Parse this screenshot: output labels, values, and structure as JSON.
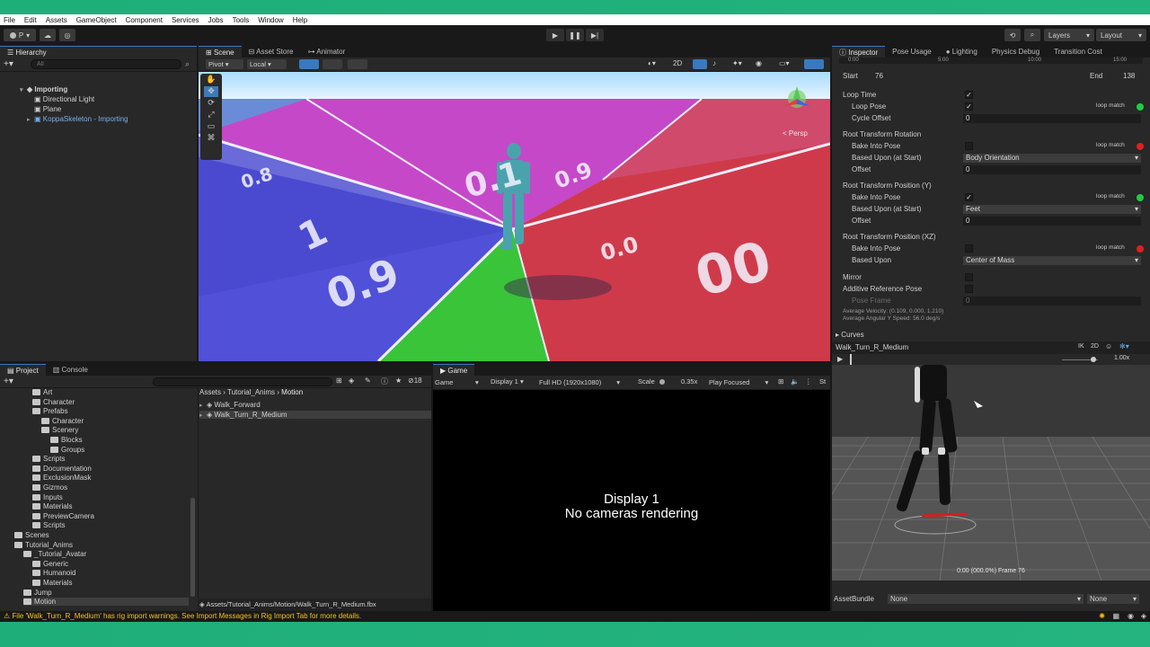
{
  "menu": [
    "File",
    "Edit",
    "Assets",
    "GameObject",
    "Component",
    "Services",
    "Jobs",
    "Tools",
    "Window",
    "Help"
  ],
  "toolbar": {
    "account": "P",
    "layers": "Layers",
    "layout": "Layout"
  },
  "hierarchy": {
    "tab": "Hierarchy",
    "search_placeholder": "All",
    "items": [
      "Importing",
      "Directional Light",
      "Plane",
      "KoppaSkeleton - Importing"
    ]
  },
  "scene": {
    "tabs": [
      "Scene",
      "Asset Store",
      "Animator"
    ],
    "pivot": "Pivot",
    "local": "Local",
    "mode_2d": "2D",
    "persp": "< Persp"
  },
  "inspector": {
    "tabs": [
      "Inspector",
      "Pose Usage",
      "Lighting",
      "Physics Debug",
      "Transition Cost"
    ],
    "timeline_ticks": [
      "0:00",
      "5:00",
      "10:00",
      "15:00"
    ],
    "start_label": "Start",
    "start_value": "76",
    "end_label": "End",
    "end_value": "138",
    "rows": {
      "loop_time": "Loop Time",
      "loop_pose": "Loop Pose",
      "cycle_offset": "Cycle Offset",
      "cycle_offset_value": "0",
      "root_rotation": "Root Transform Rotation",
      "bake_into_pose": "Bake Into Pose",
      "based_upon_start": "Based Upon (at Start)",
      "rotation_based_value": "Body Orientation",
      "offset": "Offset",
      "rotation_offset_value": "0",
      "root_position_y": "Root Transform Position (Y)",
      "position_y_based_value": "Feet",
      "position_y_offset_value": "0",
      "root_position_xz": "Root Transform Position (XZ)",
      "based_upon": "Based Upon",
      "position_xz_based_value": "Center of Mass",
      "mirror": "Mirror",
      "additive_reference_pose": "Additive Reference Pose",
      "pose_frame": "Pose Frame",
      "pose_frame_value": "0",
      "loop_match": "loop match",
      "average_velocity": "Average Velocity: (0.109, 0.000, 1.210)",
      "average_angular": "Average Angular Y Speed: 56.0 deg/s",
      "curves": "Curves"
    },
    "preview_clip": "Walk_Turn_R_Medium",
    "preview_ik": "IK",
    "preview_2d": "2D",
    "preview_speed": "1.00x",
    "preview_time": "0:00 (000.0%) Frame 76",
    "assetbundle_label": "AssetBundle",
    "assetbundle_value": "None",
    "assetbundle_variant": "None"
  },
  "project": {
    "tabs": [
      "Project",
      "Console"
    ],
    "count": "18",
    "tree": [
      {
        "label": "Art",
        "indent": 3
      },
      {
        "label": "Character",
        "indent": 3
      },
      {
        "label": "Prefabs",
        "indent": 3
      },
      {
        "label": "Character",
        "indent": 4
      },
      {
        "label": "Scenery",
        "indent": 4
      },
      {
        "label": "Blocks",
        "indent": 5
      },
      {
        "label": "Groups",
        "indent": 5
      },
      {
        "label": "Scripts",
        "indent": 3
      },
      {
        "label": "Documentation",
        "indent": 3
      },
      {
        "label": "ExclusionMask",
        "indent": 3
      },
      {
        "label": "Gizmos",
        "indent": 3
      },
      {
        "label": "Inputs",
        "indent": 3
      },
      {
        "label": "Materials",
        "indent": 3
      },
      {
        "label": "PreviewCamera",
        "indent": 3
      },
      {
        "label": "Scripts",
        "indent": 3
      },
      {
        "label": "Scenes",
        "indent": 1
      },
      {
        "label": "Tutorial_Anims",
        "indent": 1
      },
      {
        "label": "_Tutorial_Avatar",
        "indent": 2
      },
      {
        "label": "Generic",
        "indent": 3
      },
      {
        "label": "Humanoid",
        "indent": 3
      },
      {
        "label": "Materials",
        "indent": 3
      },
      {
        "label": "Jump",
        "indent": 2
      },
      {
        "label": "Motion",
        "indent": 2
      }
    ],
    "breadcrumb": [
      "Assets",
      "Tutorial_Anims",
      "Motion"
    ],
    "files": [
      "Walk_Forward",
      "Walk_Turn_R_Medium"
    ],
    "path": "Assets/Tutorial_Anims/Motion/Walk_Turn_R_Medium.fbx"
  },
  "game": {
    "tab": "Game",
    "mode": "Game",
    "display": "Display 1",
    "resolution": "Full HD (1920x1080)",
    "scale_label": "Scale",
    "scale_value": "0.35x",
    "play_focused": "Play Focused",
    "stats": "St",
    "msg_line1": "Display 1",
    "msg_line2": "No cameras rendering"
  },
  "status": {
    "message": "File 'Walk_Turn_R_Medium' has rig import warnings. See Import Messages in Rig Import Tab for more details."
  },
  "colors": {
    "accent": "#3a79bb",
    "loop_match_green": "#22cc44",
    "loop_match_red": "#e02020"
  }
}
